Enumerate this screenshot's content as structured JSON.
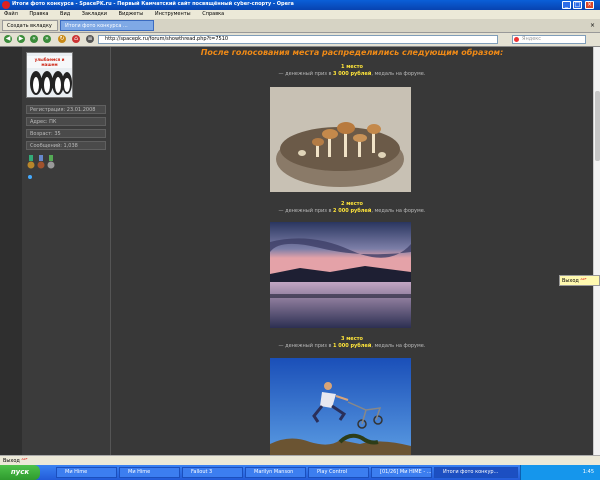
{
  "window": {
    "title": "Итоги фото конкурса - SpacePK.ru - Первый Камчатский сайт посвящённый cyber-спорту - Opera"
  },
  "menu": [
    "Файл",
    "Правка",
    "Вид",
    "Закладки",
    "Виджеты",
    "Инструменты",
    "Справка"
  ],
  "tabs": [
    {
      "label": "Создать вкладку",
      "active": false
    },
    {
      "label": "Итоги фото конкурса ...",
      "active": true
    }
  ],
  "address": {
    "url": "http://spacepk.ru/forum/showthread.php?t=7510"
  },
  "search": {
    "placeholder": "Яндекс"
  },
  "profile": {
    "avatar_text": "улыбаемся и машем",
    "registration": "Регистрация: 23.01.2008",
    "address": "Адрес: ПК",
    "age": "Возраст: 35",
    "messages": "Сообщений: 1,038"
  },
  "post": {
    "heading": "После голосования места распределились следующим образом:",
    "places": [
      {
        "title": "1 место",
        "prefix": "— денежный приз в ",
        "amount": "3 000 рублей",
        "suffix": ", медаль на форуме."
      },
      {
        "title": "2 место",
        "prefix": "— денежный приз в ",
        "amount": "2 000 рублей",
        "suffix": ", медаль на форуме."
      },
      {
        "title": "3 место",
        "prefix": "— денежный приз в ",
        "amount": "1 000 рублей",
        "suffix": ", медаль на форуме."
      }
    ]
  },
  "badges": {
    "exit": "Выход",
    "status": "Выход"
  },
  "taskbar": {
    "start": "пуск",
    "tasks": [
      "Ми Hime",
      "Ми Hime",
      "Fallout 3",
      "Marilyn Manson",
      "Play Control",
      "[01/26] Ми HIME - ...",
      "Итоги фото конкур..."
    ],
    "clock": "1:45"
  }
}
